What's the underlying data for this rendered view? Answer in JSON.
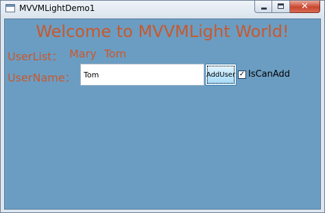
{
  "window": {
    "title": "MVVMLightDemo1",
    "close_glyph": "✕"
  },
  "main": {
    "welcome": "Welcome to MVVMLight World!",
    "userlist_label": "UserList：",
    "userlist_names": "Mary Tom",
    "username_label": "UserName：",
    "username_value": "Tom",
    "add_button_label": "AddUser",
    "checkbox_checked": true,
    "checkbox_mark": "✓",
    "checkbox_label": "IsCanAdd"
  },
  "colors": {
    "client_background": "#6b9dc2",
    "text_accent": "#c9582c"
  },
  "icons": [
    "app-icon",
    "minimize-icon",
    "maximize-icon",
    "close-icon",
    "checkmark-icon"
  ]
}
